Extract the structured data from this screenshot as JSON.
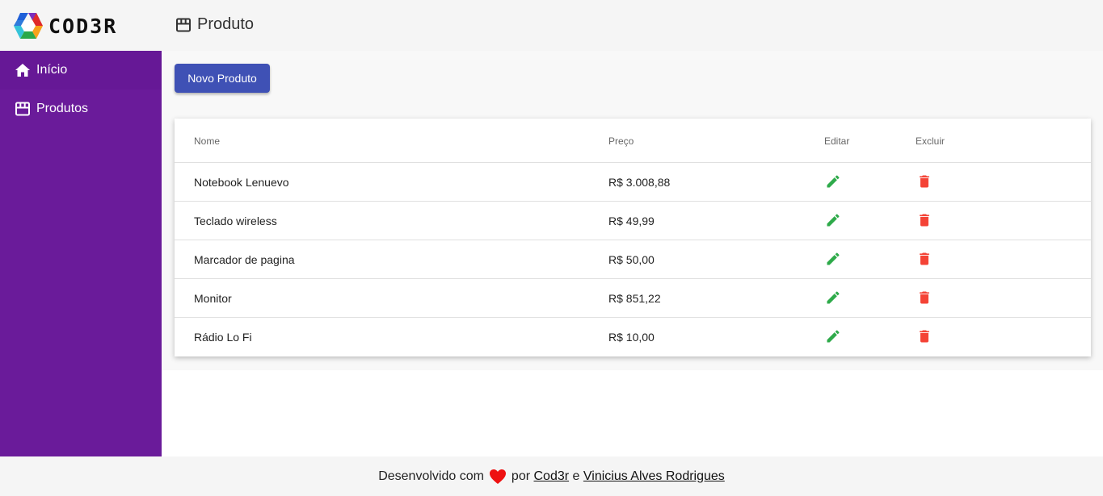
{
  "header": {
    "logo_text": "COD3R",
    "page_title": "Produto",
    "page_icon": "store-icon"
  },
  "sidebar": {
    "items": [
      {
        "label": "Início",
        "icon": "home-icon"
      },
      {
        "label": "Produtos",
        "icon": "store-icon"
      }
    ]
  },
  "main": {
    "new_button_label": "Novo Produto",
    "table": {
      "headers": {
        "nome": "Nome",
        "preco": "Preço",
        "editar": "Editar",
        "excluir": "Excluir"
      },
      "rows": [
        {
          "nome": "Notebook Lenuevo",
          "preco": "R$ 3.008,88"
        },
        {
          "nome": "Teclado wireless",
          "preco": "R$ 49,99"
        },
        {
          "nome": "Marcador de pagina",
          "preco": "R$ 50,00"
        },
        {
          "nome": "Monitor",
          "preco": "R$ 851,22"
        },
        {
          "nome": "Rádio Lo Fi",
          "preco": "R$ 10,00"
        }
      ]
    }
  },
  "footer": {
    "prefix": "Desenvolvido com",
    "por": "por",
    "link1": "Cod3r",
    "and": "e",
    "link2": "Vinicius Alves Rodrigues"
  },
  "colors": {
    "sidebar": "#6a1b9a",
    "button": "#3f51b5",
    "edit": "#2eaa4a",
    "delete": "#f44336",
    "heart": "#ee1111"
  }
}
